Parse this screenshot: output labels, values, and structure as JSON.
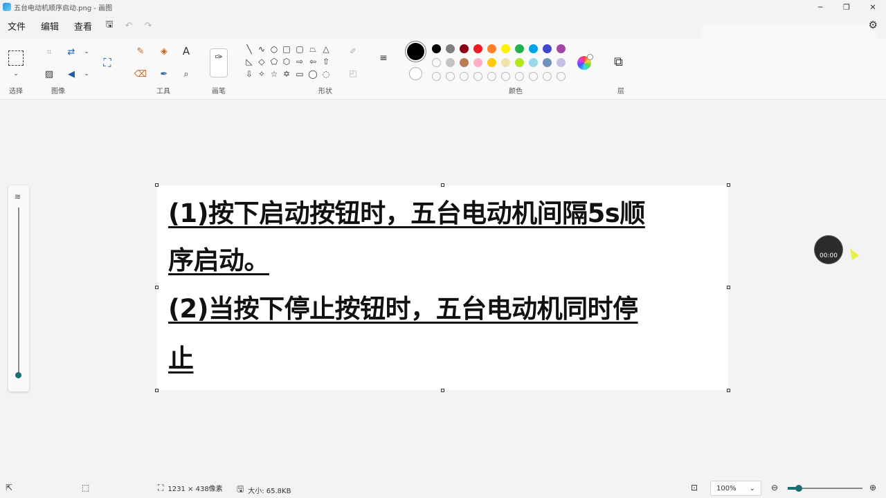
{
  "window": {
    "title": "五台电动机顺序启动.png - 画图",
    "controls": [
      "minimize-icon",
      "restore-icon",
      "close-icon"
    ]
  },
  "menu": {
    "items": [
      "文件",
      "编辑",
      "查看"
    ]
  },
  "ribbon": {
    "groups": {
      "select": "选择",
      "image": "图像",
      "tools": "工具",
      "brushes": "画笔",
      "shapes": "形状",
      "colors": "颜色",
      "layers": "层"
    }
  },
  "colors": {
    "primary": "#000000",
    "secondary": "#ffffff",
    "row1": [
      "#000000",
      "#7f7f7f",
      "#880015",
      "#ed1c24",
      "#ff7f27",
      "#fff200",
      "#22b14c",
      "#00a2e8",
      "#3f48cc",
      "#a349a4"
    ],
    "row2": [
      "",
      "#c3c3c3",
      "#b97a57",
      "#ffaec9",
      "#ffc90e",
      "#efe4b0",
      "#b5e61d",
      "#99d9ea",
      "#7092be",
      "#c8bfe7"
    ]
  },
  "canvas": {
    "lines": [
      "(1)按下启动按钮时，五台电动机间隔5s顺",
      "序启动。",
      "(2)当按下停止按钮时，五台电动机同时停",
      "止"
    ]
  },
  "recorder": {
    "time": "00:00"
  },
  "status": {
    "dimensions": "1231 × 438像素",
    "size": "大小: 65.8KB",
    "zoom": "100%"
  }
}
